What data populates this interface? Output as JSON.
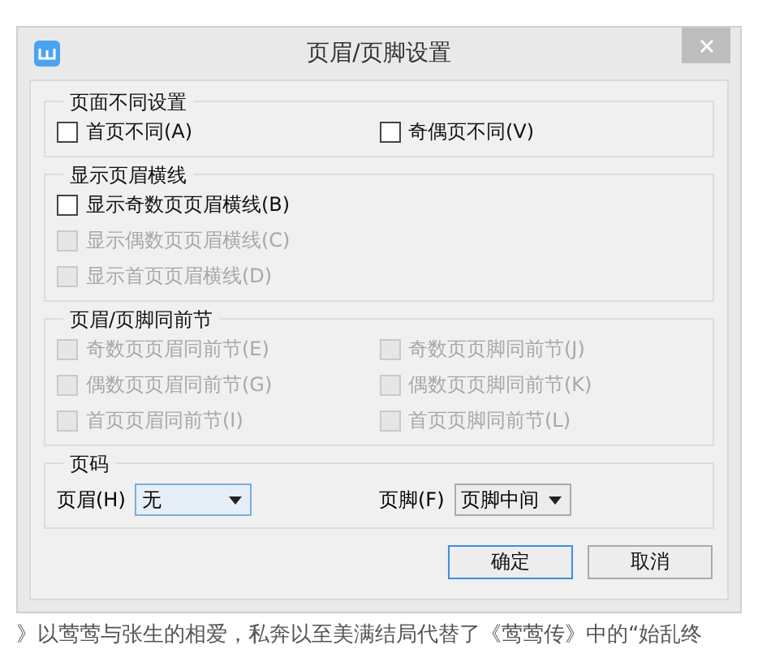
{
  "window": {
    "title": "页眉/页脚设置"
  },
  "groups": [
    {
      "legend": "页面不同设置",
      "kind": "grid",
      "options": [
        {
          "label": "首页不同(A)",
          "checked": false,
          "disabled": false
        },
        {
          "label": "奇偶页不同(V)",
          "checked": false,
          "disabled": false
        }
      ]
    },
    {
      "legend": "显示页眉横线",
      "kind": "stack",
      "options": [
        {
          "label": "显示奇数页页眉横线(B)",
          "checked": false,
          "disabled": false
        },
        {
          "label": "显示偶数页页眉横线(C)",
          "checked": false,
          "disabled": true
        },
        {
          "label": "显示首页页眉横线(D)",
          "checked": false,
          "disabled": true
        }
      ]
    },
    {
      "legend": "页眉/页脚同前节",
      "kind": "grid",
      "options": [
        {
          "label": "奇数页页眉同前节(E)",
          "checked": false,
          "disabled": true
        },
        {
          "label": "奇数页页脚同前节(J)",
          "checked": false,
          "disabled": true
        },
        {
          "label": "偶数页页眉同前节(G)",
          "checked": false,
          "disabled": true
        },
        {
          "label": "偶数页页脚同前节(K)",
          "checked": false,
          "disabled": true
        },
        {
          "label": "首页页眉同前节(I)",
          "checked": false,
          "disabled": true
        },
        {
          "label": "首页页脚同前节(L)",
          "checked": false,
          "disabled": true
        }
      ]
    }
  ],
  "page_number": {
    "legend": "页码",
    "selects": [
      {
        "label": "页眉(H)",
        "value": "无",
        "focused": true
      },
      {
        "label": "页脚(F)",
        "value": "页脚中间",
        "focused": false
      }
    ]
  },
  "buttons": [
    {
      "label": "确定",
      "default": true
    },
    {
      "label": "取消",
      "default": false
    }
  ],
  "background_text": "》以莺莺与张生的相爱，私奔以至美满结局代替了《莺莺传》中的“始乱终"
}
